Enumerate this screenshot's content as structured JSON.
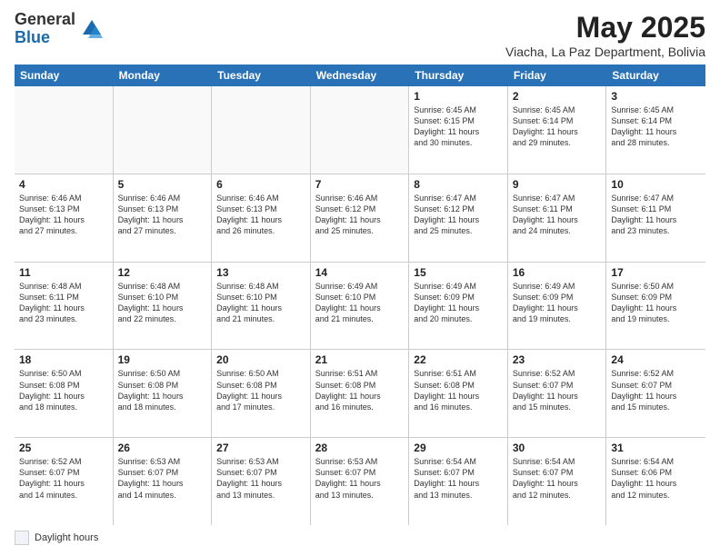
{
  "logo": {
    "general": "General",
    "blue": "Blue"
  },
  "header": {
    "month_title": "May 2025",
    "subtitle": "Viacha, La Paz Department, Bolivia"
  },
  "days_of_week": [
    "Sunday",
    "Monday",
    "Tuesday",
    "Wednesday",
    "Thursday",
    "Friday",
    "Saturday"
  ],
  "weeks": [
    [
      {
        "day": "",
        "info": "",
        "empty": true
      },
      {
        "day": "",
        "info": "",
        "empty": true
      },
      {
        "day": "",
        "info": "",
        "empty": true
      },
      {
        "day": "",
        "info": "",
        "empty": true
      },
      {
        "day": "1",
        "info": "Sunrise: 6:45 AM\nSunset: 6:15 PM\nDaylight: 11 hours\nand 30 minutes.",
        "empty": false
      },
      {
        "day": "2",
        "info": "Sunrise: 6:45 AM\nSunset: 6:14 PM\nDaylight: 11 hours\nand 29 minutes.",
        "empty": false
      },
      {
        "day": "3",
        "info": "Sunrise: 6:45 AM\nSunset: 6:14 PM\nDaylight: 11 hours\nand 28 minutes.",
        "empty": false
      }
    ],
    [
      {
        "day": "4",
        "info": "Sunrise: 6:46 AM\nSunset: 6:13 PM\nDaylight: 11 hours\nand 27 minutes.",
        "empty": false
      },
      {
        "day": "5",
        "info": "Sunrise: 6:46 AM\nSunset: 6:13 PM\nDaylight: 11 hours\nand 27 minutes.",
        "empty": false
      },
      {
        "day": "6",
        "info": "Sunrise: 6:46 AM\nSunset: 6:13 PM\nDaylight: 11 hours\nand 26 minutes.",
        "empty": false
      },
      {
        "day": "7",
        "info": "Sunrise: 6:46 AM\nSunset: 6:12 PM\nDaylight: 11 hours\nand 25 minutes.",
        "empty": false
      },
      {
        "day": "8",
        "info": "Sunrise: 6:47 AM\nSunset: 6:12 PM\nDaylight: 11 hours\nand 25 minutes.",
        "empty": false
      },
      {
        "day": "9",
        "info": "Sunrise: 6:47 AM\nSunset: 6:11 PM\nDaylight: 11 hours\nand 24 minutes.",
        "empty": false
      },
      {
        "day": "10",
        "info": "Sunrise: 6:47 AM\nSunset: 6:11 PM\nDaylight: 11 hours\nand 23 minutes.",
        "empty": false
      }
    ],
    [
      {
        "day": "11",
        "info": "Sunrise: 6:48 AM\nSunset: 6:11 PM\nDaylight: 11 hours\nand 23 minutes.",
        "empty": false
      },
      {
        "day": "12",
        "info": "Sunrise: 6:48 AM\nSunset: 6:10 PM\nDaylight: 11 hours\nand 22 minutes.",
        "empty": false
      },
      {
        "day": "13",
        "info": "Sunrise: 6:48 AM\nSunset: 6:10 PM\nDaylight: 11 hours\nand 21 minutes.",
        "empty": false
      },
      {
        "day": "14",
        "info": "Sunrise: 6:49 AM\nSunset: 6:10 PM\nDaylight: 11 hours\nand 21 minutes.",
        "empty": false
      },
      {
        "day": "15",
        "info": "Sunrise: 6:49 AM\nSunset: 6:09 PM\nDaylight: 11 hours\nand 20 minutes.",
        "empty": false
      },
      {
        "day": "16",
        "info": "Sunrise: 6:49 AM\nSunset: 6:09 PM\nDaylight: 11 hours\nand 19 minutes.",
        "empty": false
      },
      {
        "day": "17",
        "info": "Sunrise: 6:50 AM\nSunset: 6:09 PM\nDaylight: 11 hours\nand 19 minutes.",
        "empty": false
      }
    ],
    [
      {
        "day": "18",
        "info": "Sunrise: 6:50 AM\nSunset: 6:08 PM\nDaylight: 11 hours\nand 18 minutes.",
        "empty": false
      },
      {
        "day": "19",
        "info": "Sunrise: 6:50 AM\nSunset: 6:08 PM\nDaylight: 11 hours\nand 18 minutes.",
        "empty": false
      },
      {
        "day": "20",
        "info": "Sunrise: 6:50 AM\nSunset: 6:08 PM\nDaylight: 11 hours\nand 17 minutes.",
        "empty": false
      },
      {
        "day": "21",
        "info": "Sunrise: 6:51 AM\nSunset: 6:08 PM\nDaylight: 11 hours\nand 16 minutes.",
        "empty": false
      },
      {
        "day": "22",
        "info": "Sunrise: 6:51 AM\nSunset: 6:08 PM\nDaylight: 11 hours\nand 16 minutes.",
        "empty": false
      },
      {
        "day": "23",
        "info": "Sunrise: 6:52 AM\nSunset: 6:07 PM\nDaylight: 11 hours\nand 15 minutes.",
        "empty": false
      },
      {
        "day": "24",
        "info": "Sunrise: 6:52 AM\nSunset: 6:07 PM\nDaylight: 11 hours\nand 15 minutes.",
        "empty": false
      }
    ],
    [
      {
        "day": "25",
        "info": "Sunrise: 6:52 AM\nSunset: 6:07 PM\nDaylight: 11 hours\nand 14 minutes.",
        "empty": false
      },
      {
        "day": "26",
        "info": "Sunrise: 6:53 AM\nSunset: 6:07 PM\nDaylight: 11 hours\nand 14 minutes.",
        "empty": false
      },
      {
        "day": "27",
        "info": "Sunrise: 6:53 AM\nSunset: 6:07 PM\nDaylight: 11 hours\nand 13 minutes.",
        "empty": false
      },
      {
        "day": "28",
        "info": "Sunrise: 6:53 AM\nSunset: 6:07 PM\nDaylight: 11 hours\nand 13 minutes.",
        "empty": false
      },
      {
        "day": "29",
        "info": "Sunrise: 6:54 AM\nSunset: 6:07 PM\nDaylight: 11 hours\nand 13 minutes.",
        "empty": false
      },
      {
        "day": "30",
        "info": "Sunrise: 6:54 AM\nSunset: 6:07 PM\nDaylight: 11 hours\nand 12 minutes.",
        "empty": false
      },
      {
        "day": "31",
        "info": "Sunrise: 6:54 AM\nSunset: 6:06 PM\nDaylight: 11 hours\nand 12 minutes.",
        "empty": false
      }
    ]
  ],
  "legend": {
    "label": "Daylight hours"
  }
}
